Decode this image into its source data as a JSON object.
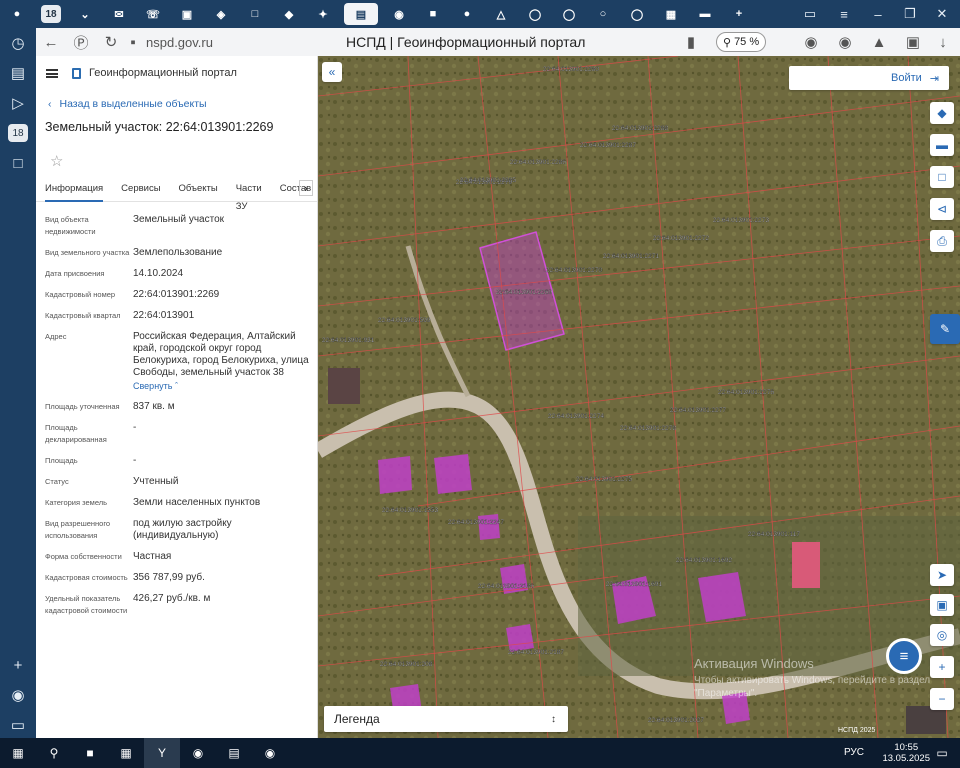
{
  "browser": {
    "tab_counter": "18",
    "url": "nspd.gov.ru",
    "page_title": "НСПД | Геоинформационный портал",
    "zoom": "75 %",
    "rail_counter": "18"
  },
  "panel": {
    "app_title": "Геоинформационный портал",
    "back_link": "Назад в выделенные объекты",
    "parcel_title": "Земельный участок: 22:64:013901:2269",
    "tabs": [
      "Информация",
      "Сервисы",
      "Объекты",
      "Части ЗУ",
      "Состав"
    ],
    "props": [
      {
        "label": "Вид объекта недвижимости",
        "value": "Земельный участок"
      },
      {
        "label": "Вид земельного участка",
        "value": "Землепользование"
      },
      {
        "label": "Дата присвоения",
        "value": "14.10.2024"
      },
      {
        "label": "Кадастровый номер",
        "value": "22:64:013901:2269"
      },
      {
        "label": "Кадастровый квартал",
        "value": "22:64:013901"
      },
      {
        "label": "Адрес",
        "value": "Российская Федерация, Алтайский край, городской округ город Белокуриха, город Белокуриха, улица Свободы, земельный участок 38"
      },
      {
        "label": "Площадь уточненная",
        "value": "837 кв. м"
      },
      {
        "label": "Площадь декларированная",
        "value": "-"
      },
      {
        "label": "Площадь",
        "value": "-"
      },
      {
        "label": "Статус",
        "value": "Учтенный"
      },
      {
        "label": "Категория земель",
        "value": "Земли населенных пунктов"
      },
      {
        "label": "Вид разрешенного использования",
        "value": "под жилую застройку (индивидуальную)"
      },
      {
        "label": "Форма собственности",
        "value": "Частная"
      },
      {
        "label": "Кадастровая стоимость",
        "value": "356 787,99 руб."
      },
      {
        "label": "Удельный показатель кадастровой стоимости",
        "value": "426,27 руб./кв. м"
      }
    ],
    "collapse_label": "Свернуть"
  },
  "map": {
    "login_label": "Войти",
    "legend_label": "Легенда",
    "watermark_title": "Активация Windows",
    "watermark_text": "Чтобы активировать Windows, перейдите в раздел \"Параметры\".",
    "scale_label": "НСПД 2025",
    "parcel_labels": [
      "22:64:013901:2269",
      "22:64:013901:2270",
      "22:64:013901:2271",
      "22:64:013901:2272",
      "22:64:013901:2273",
      "22:64:013901:2274",
      "22:64:013901:2275",
      "22:64:013901:2276",
      "22:64:013901:2277",
      "22:64:013901:2278",
      "22:64:013901:2279",
      "22:64:013901:2288",
      "22:64:013901:2287",
      "22:64:013901:2286",
      "22:64:013901:2285",
      "22:64:013901:2280",
      "22:64:013901:2247",
      "22:64:013901:2186",
      "22:64:013901:1691",
      "22:64:013901:1692",
      "22:64:013901:117",
      "22:64:013901:2187",
      "22:64:013901:2027",
      "22:64:013901:1553",
      "22:64:013901:599",
      "22:64:013901:931",
      "22:64:013901:208"
    ],
    "colors": {
      "selected": "#c040c8",
      "boundary": "#e04848"
    }
  },
  "taskbar": {
    "lang": "РУС",
    "time": "10:55",
    "date": "13.05.2025"
  }
}
